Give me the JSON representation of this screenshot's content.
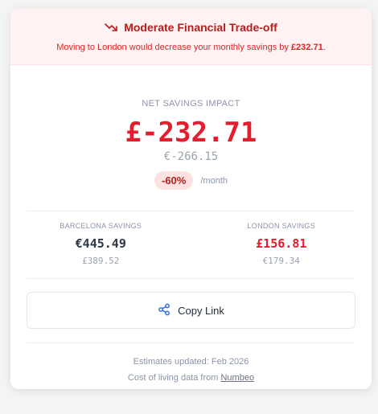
{
  "banner": {
    "icon": "trending-down-icon",
    "title": "Moderate Financial Trade-off",
    "subtitle_prefix": "Moving to London would decrease your monthly savings by ",
    "subtitle_amount": "£232.71",
    "subtitle_suffix": ".",
    "color": "#b91c1c",
    "background": "#fef2f2"
  },
  "impact": {
    "label": "NET SAVINGS IMPACT",
    "amount_gbp": "£-232.71",
    "amount_eur": "€-266.15",
    "percent": "-60%",
    "period": "/month"
  },
  "comparison": {
    "barcelona": {
      "label": "BARCELONA SAVINGS",
      "primary": "€445.49",
      "secondary": "£389.52"
    },
    "london": {
      "label": "LONDON SAVINGS",
      "primary": "£156.81",
      "secondary": "€179.34"
    }
  },
  "copy_button": {
    "icon": "share-icon",
    "label": "Copy Link"
  },
  "footer": {
    "updated": "Estimates updated: Feb 2026",
    "source_prefix": "Cost of living data from ",
    "source_link": "Numbeo"
  },
  "colors": {
    "negative": "#e11d2e",
    "accent_blue": "#2563eb",
    "muted": "#8a94a6"
  }
}
